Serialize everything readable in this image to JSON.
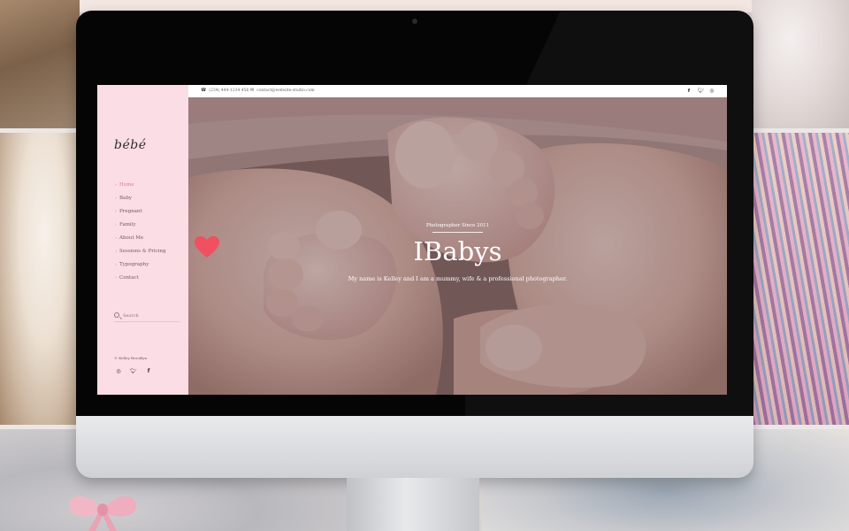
{
  "theme": {
    "sidebar_bg": "#fbdde6",
    "accent": "#e07a94",
    "heart": "#f0505f"
  },
  "site": {
    "logo": "bébé"
  },
  "topbar": {
    "phone": "(234) 444-1234 456",
    "email": "contact@website-studio.com",
    "phone_icon": "phone-icon",
    "email_icon": "envelope-icon"
  },
  "social": [
    "facebook",
    "twitter",
    "instagram"
  ],
  "sidebar": {
    "nav": [
      {
        "label": "Home",
        "active": true
      },
      {
        "label": "Baby",
        "active": false
      },
      {
        "label": "Pregnant",
        "active": false
      },
      {
        "label": "Family",
        "active": false
      },
      {
        "label": "About Me",
        "active": false
      },
      {
        "label": "Sessions & Pricing",
        "active": false
      },
      {
        "label": "Typography",
        "active": false
      },
      {
        "label": "Contact",
        "active": false
      }
    ],
    "search_placeholder": "Search",
    "copyright": "© Kelley Brooklyn",
    "social": [
      "instagram",
      "twitter",
      "facebook"
    ]
  },
  "hero": {
    "kicker": "Photographer Since 2011",
    "title_left": "I",
    "title_icon": "heart-icon",
    "title_right": "Babys",
    "subtitle": "My name is Kelley and I am a mummy, wife & a professional photographer."
  }
}
